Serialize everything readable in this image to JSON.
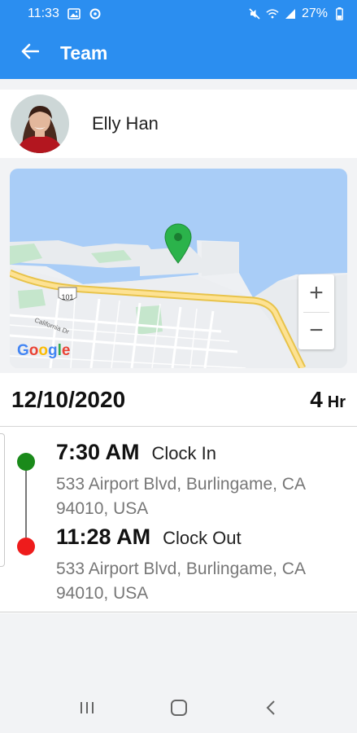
{
  "status_bar": {
    "time": "11:33",
    "battery": "27%",
    "icons": [
      "image-icon",
      "sync-icon",
      "mute-icon",
      "wifi-icon",
      "signal-icon",
      "battery-icon"
    ]
  },
  "app_bar": {
    "title": "Team",
    "back_icon": "arrow-left-icon"
  },
  "profile": {
    "name": "Elly Han"
  },
  "map": {
    "zoom_in": "+",
    "zoom_out": "−",
    "attribution": [
      "G",
      "o",
      "o",
      "g",
      "l",
      "e"
    ],
    "highway_label": "101",
    "street_label": "California Dr",
    "pin_color": "#2bb34b"
  },
  "shift": {
    "date": "12/10/2020",
    "hours_value": "4",
    "hours_unit": "Hr",
    "events": [
      {
        "time": "7:30 AM",
        "label": "Clock In",
        "address": "533 Airport Blvd, Burlingame, CA 94010, USA",
        "color": "#1a8a1a"
      },
      {
        "time": "11:28 AM",
        "label": "Clock Out",
        "address": "533 Airport Blvd, Burlingame, CA 94010, USA",
        "color": "#ee1c1c"
      }
    ]
  },
  "nav_bar": {
    "icons": [
      "recents-icon",
      "home-icon",
      "back-icon"
    ]
  },
  "colors": {
    "primary": "#2b8ef0",
    "water": "#a9cdf7",
    "land": "#eef0f3"
  }
}
